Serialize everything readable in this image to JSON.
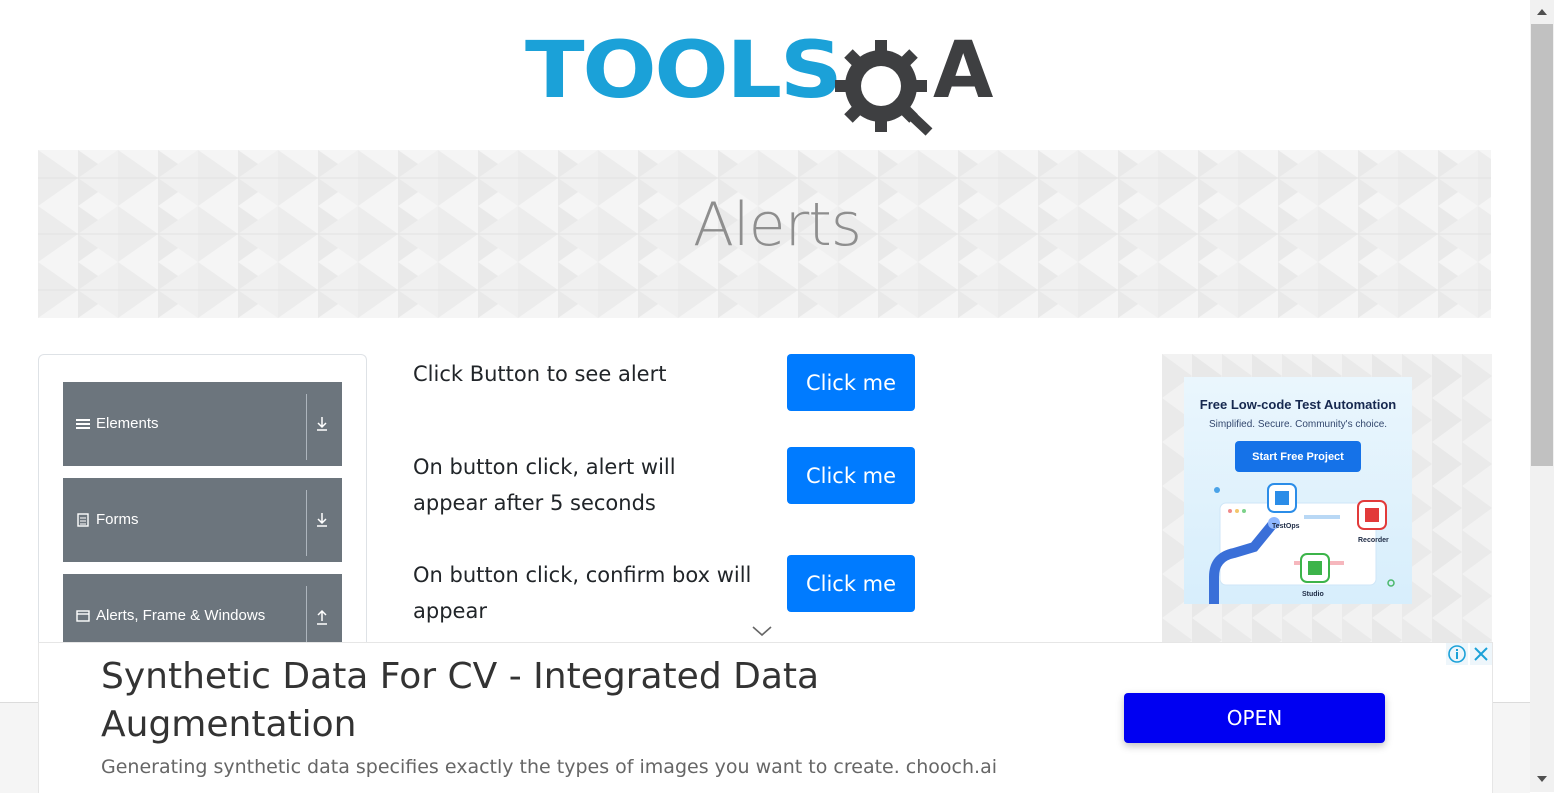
{
  "header": {
    "logo_left": "TOOLS",
    "logo_right": "A",
    "logo_icon": "gear-magnifier-icon"
  },
  "banner": {
    "title": "Alerts"
  },
  "sidebar": {
    "groups": [
      {
        "label": "Elements",
        "icon": "hamburger-icon",
        "arrow": "download-arrow-icon"
      },
      {
        "label": "Forms",
        "icon": "form-document-icon",
        "arrow": "download-arrow-icon"
      },
      {
        "label": "Alerts, Frame & Windows",
        "icon": "window-icon",
        "arrow": "upload-arrow-icon"
      }
    ]
  },
  "main": {
    "rows": [
      {
        "label": "Click Button to see alert",
        "button": "Click me"
      },
      {
        "label": "On button click, alert will appear after 5 seconds",
        "button": "Click me"
      },
      {
        "label": "On button click, confirm box will appear",
        "button": "Click me"
      }
    ]
  },
  "right_ad": {
    "title": "Free Low-code Test Automation",
    "subtitle": "Simplified. Secure. Community's choice.",
    "button": "Start Free Project",
    "labels": [
      "TestOps",
      "Recorder",
      "Studio"
    ]
  },
  "bottom_ad": {
    "title": "Synthetic Data For CV - Integrated Data Augmentation",
    "description": "Generating synthetic data specifies exactly the types of images you want to create. chooch.ai",
    "button": "OPEN"
  },
  "colors": {
    "primary": "#007bff",
    "nav_gray": "#6c757d",
    "logo_blue": "#1ba1d8",
    "logo_dark": "#3e3f41",
    "open_blue": "#0000f2"
  }
}
